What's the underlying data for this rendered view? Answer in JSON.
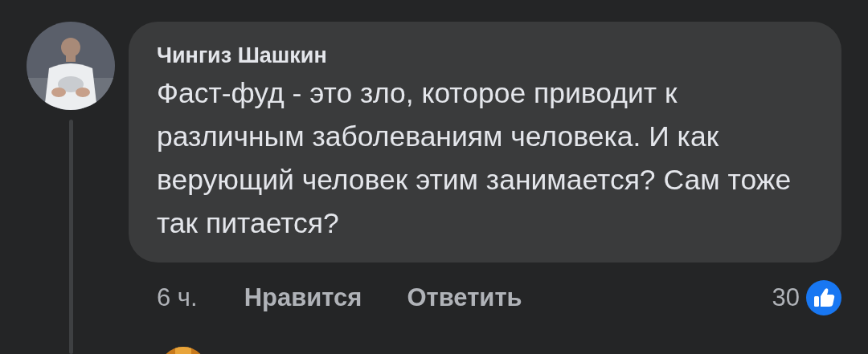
{
  "comment": {
    "author": "Чингиз Шашкин",
    "text": "Фаст-фуд - это зло, которое приводит к различным заболеваниям человека. И как верующий человек этим занимается? Сам тоже так питается?",
    "time": "6 ч.",
    "actions": [
      "Нравится",
      "Ответить"
    ],
    "reaction_count": "30"
  }
}
